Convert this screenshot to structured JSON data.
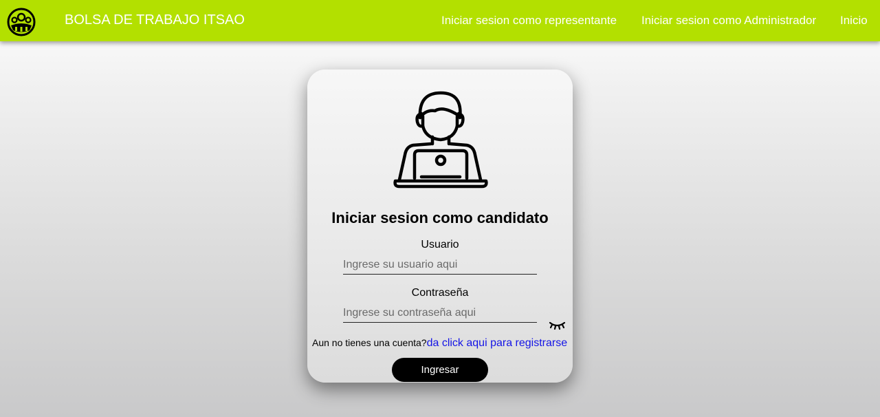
{
  "navbar": {
    "logo_icon": "people-group-logo-icon",
    "brand": "BOLSA DE TRABAJO ITSAO",
    "links": [
      {
        "label": "Iniciar sesion como representante"
      },
      {
        "label": "Iniciar sesion como Administrador"
      },
      {
        "label": "Inicio"
      }
    ],
    "color": "#b3e000"
  },
  "login": {
    "avatar_icon": "person-at-laptop-icon",
    "title": "Iniciar sesion como candidato",
    "user_label": "Usuario",
    "user_placeholder": "Ingrese su usuario aqui",
    "user_value": "",
    "password_label": "Contraseña",
    "password_placeholder": "Ingrese su contraseña aqui",
    "password_value": "",
    "toggle_icon": "eye-closed-icon",
    "register_prompt": "Aun no tienes una cuenta?",
    "register_link": "da click aqui para registrarse",
    "submit_label": "Ingresar"
  },
  "colors": {
    "accent": "#b3e000",
    "link": "#1414e6",
    "button": "#000000"
  }
}
